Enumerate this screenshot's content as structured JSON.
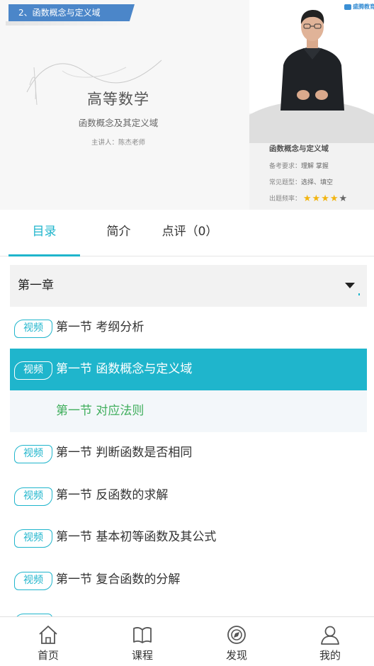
{
  "player": {
    "ribbon_title": "2、函数概念与定义域",
    "course_title": "高等数学",
    "course_subtitle": "函数概念及其定义域",
    "teacher": "主讲人：陈杰老师",
    "brand": "盛腾教育",
    "info": {
      "title": "函数概念与定义域",
      "requirement_label": "备考要求：",
      "requirement_value": "理解 掌握",
      "question_type_label": "常见题型：",
      "question_type_value": "选择、填空",
      "frequency_label": "出题频率：",
      "frequency_stars": 4,
      "frequency_max": 5
    }
  },
  "tabs": [
    {
      "label": "目录",
      "active": true
    },
    {
      "label": "简介",
      "active": false
    },
    {
      "label": "点评（0）",
      "active": false
    }
  ],
  "chapter": {
    "title": "第一章",
    "expanded": true
  },
  "lessons": [
    {
      "badge": "视频",
      "label": "第一节 考纲分析",
      "state": "normal"
    },
    {
      "badge": "视频",
      "label": "第一节 函数概念与定义域",
      "state": "selected"
    },
    {
      "badge": "",
      "label": "第一节 对应法则",
      "state": "sub"
    },
    {
      "badge": "视频",
      "label": "第一节 判断函数是否相同",
      "state": "normal"
    },
    {
      "badge": "视频",
      "label": "第一节 反函数的求解",
      "state": "normal"
    },
    {
      "badge": "视频",
      "label": "第一节 基本初等函数及其公式",
      "state": "normal"
    },
    {
      "badge": "视频",
      "label": "第一节 复合函数的分解",
      "state": "normal"
    }
  ],
  "nav": [
    {
      "label": "首页",
      "icon": "home-icon"
    },
    {
      "label": "课程",
      "icon": "book-icon"
    },
    {
      "label": "发现",
      "icon": "discover-icon"
    },
    {
      "label": "我的",
      "icon": "profile-icon"
    }
  ],
  "colors": {
    "accent": "#1fb5cc",
    "sub_lesson_text": "#3fae5c",
    "star": "#f2b511"
  }
}
